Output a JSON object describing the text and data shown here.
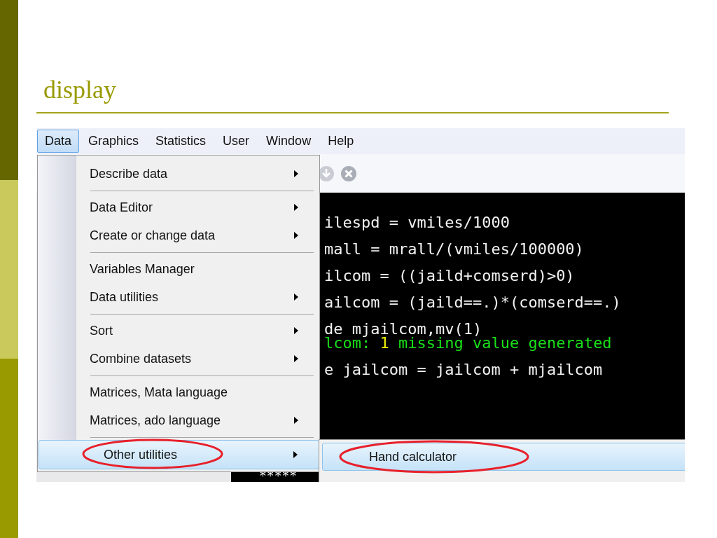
{
  "slide": {
    "title": "display"
  },
  "menubar": [
    {
      "label": "Data",
      "selected": true
    },
    {
      "label": "Graphics",
      "selected": false
    },
    {
      "label": "Statistics",
      "selected": false
    },
    {
      "label": "User",
      "selected": false
    },
    {
      "label": "Window",
      "selected": false
    },
    {
      "label": "Help",
      "selected": false
    }
  ],
  "data_menu": {
    "groups": [
      {
        "items": [
          {
            "label": "Describe data",
            "has_submenu": true,
            "selected": false,
            "circled": false
          }
        ]
      },
      {
        "items": [
          {
            "label": "Data Editor",
            "has_submenu": true,
            "selected": false,
            "circled": false
          },
          {
            "label": "Create or change data",
            "has_submenu": true,
            "selected": false,
            "circled": false
          }
        ]
      },
      {
        "items": [
          {
            "label": "Variables Manager",
            "has_submenu": false,
            "selected": false,
            "circled": false
          },
          {
            "label": "Data utilities",
            "has_submenu": true,
            "selected": false,
            "circled": false
          }
        ]
      },
      {
        "items": [
          {
            "label": "Sort",
            "has_submenu": true,
            "selected": false,
            "circled": false
          },
          {
            "label": "Combine datasets",
            "has_submenu": true,
            "selected": false,
            "circled": false
          }
        ]
      },
      {
        "items": [
          {
            "label": "Matrices, Mata language",
            "has_submenu": false,
            "selected": false,
            "circled": false
          },
          {
            "label": "Matrices, ado language",
            "has_submenu": true,
            "selected": false,
            "circled": false
          }
        ]
      },
      {
        "items": [
          {
            "label": "Other utilities",
            "has_submenu": true,
            "selected": true,
            "circled": true
          }
        ]
      }
    ]
  },
  "submenu": {
    "items": [
      {
        "label": "Hand calculator",
        "selected": true,
        "circled": true
      }
    ]
  },
  "console": {
    "lines": [
      {
        "kind": "command",
        "segments": [
          {
            "kind": "input",
            "text": "ilespd = vmiles/1000"
          }
        ]
      },
      {
        "kind": "command",
        "segments": [
          {
            "kind": "input",
            "text": "mall = mrall/(vmiles/100000)"
          }
        ]
      },
      {
        "kind": "command",
        "segments": [
          {
            "kind": "input",
            "text": "ilcom = ((jaild+comserd)>0)"
          }
        ]
      },
      {
        "kind": "command",
        "segments": [
          {
            "kind": "input",
            "text": "ailcom = (jaild==.)*(comserd==.)"
          }
        ]
      },
      {
        "kind": "command",
        "segments": [
          {
            "kind": "input",
            "text": "de mjailcom,mv(1)"
          }
        ]
      },
      {
        "kind": "result",
        "segments": [
          {
            "kind": "output",
            "text": "lcom: "
          },
          {
            "kind": "number",
            "text": "1"
          },
          {
            "kind": "output",
            "text": " missing value generated"
          }
        ]
      },
      {
        "kind": "command",
        "segments": [
          {
            "kind": "input",
            "text": "e jailcom = jailcom + mjailcom"
          }
        ]
      },
      {
        "kind": "rule",
        "segments": [
          {
            "kind": "input",
            "text": "*****"
          }
        ]
      }
    ]
  }
}
